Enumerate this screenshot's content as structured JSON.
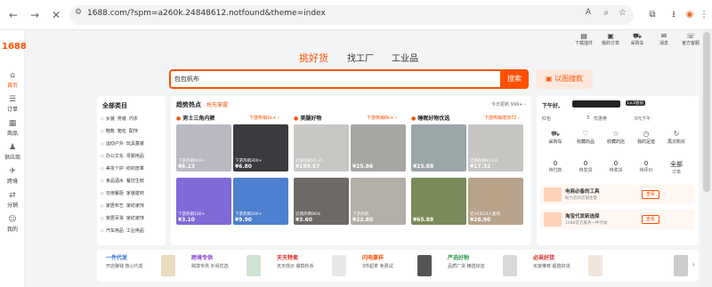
{
  "browser": {
    "url": "1688.com/?spm=a260k.24848612.notfound&theme=index",
    "back_icon": "←",
    "forward_icon": "→",
    "reload_icon": "✕",
    "info_icon": "⚙",
    "translate_icon": "A",
    "zoom_icon": "⌕",
    "star_icon": "☆",
    "extensions_icon": "⧉",
    "download_icon": "⭳",
    "avatar_icon": "◉",
    "menu_icon": "⋮"
  },
  "site": {
    "logo": "1688",
    "rail": [
      {
        "icon": "⌂",
        "label": "首页"
      },
      {
        "icon": "☰",
        "label": "订单"
      },
      {
        "icon": "▦",
        "label": "商品"
      },
      {
        "icon": "♟",
        "label": "供应商"
      },
      {
        "icon": "✈",
        "label": "跨境"
      },
      {
        "icon": "⇄",
        "label": "分销"
      },
      {
        "icon": "☺",
        "label": "我的"
      }
    ],
    "top_icons": [
      {
        "icon": "▤",
        "label": "下载插件"
      },
      {
        "icon": "▣",
        "label": "我的订单"
      },
      {
        "icon": "⛟",
        "label": "采购车"
      },
      {
        "icon": "✉",
        "label": "消息"
      },
      {
        "icon": "☏",
        "label": "官方客服"
      }
    ],
    "tabs": [
      "挑好货",
      "找工厂",
      "工业品"
    ],
    "search_value": "包包帆布",
    "search_button": "搜索",
    "image_search": "以图搜款",
    "image_search_icon": "▣",
    "accent": "#ff5000"
  },
  "categories": {
    "title": "全部类目",
    "rows": [
      [
        "女装",
        "男装",
        "内衣"
      ],
      [
        "鞋靴",
        "箱包",
        "配饰"
      ],
      [
        "运动户外",
        "玩具童装"
      ],
      [
        "办公文化",
        "母婴用品"
      ],
      [
        "美妆个护",
        "纺织皮革"
      ],
      [
        "食品酒水",
        "餐饮生鲜"
      ],
      [
        "日用餐厨",
        "家装建材"
      ],
      [
        "家居布艺",
        "家纺家饰"
      ],
      [
        "家居百货",
        "家纺家饰"
      ],
      [
        "汽车用品",
        "工业用品"
      ]
    ],
    "row_icon": "◇"
  },
  "hot": {
    "title": "趋势热点",
    "subtitle": "抢先掌握",
    "more": "今日更新 999+ ›",
    "columns": [
      {
        "title": "男士三角内裤",
        "sub": "下游热销1k+ ›",
        "tiles": [
          {
            "cap": "下游热销600+",
            "price": "¥6.23",
            "color": "#b9b9c2"
          },
          {
            "cap": "下游热销300+",
            "price": "¥6.80",
            "color": "#3a3a3f"
          },
          {
            "cap": "下游热销100+",
            "price": "¥3.10",
            "color": "#7f6ad8"
          },
          {
            "cap": "下游热销200+",
            "price": "¥9.90",
            "color": "#4f7fcf"
          }
        ]
      },
      {
        "title": "美腿好物",
        "sub": "下游热销6k+ ›",
        "tiles": [
          {
            "cap": "近期热销¥5.25",
            "price": "¥189.57",
            "color": "#c9c7c4"
          },
          {
            "cap": "",
            "price": "¥25.86",
            "color": "#a8a6a3"
          },
          {
            "cap": "近期热销96%",
            "price": "¥3.60",
            "color": "#6d6a66"
          },
          {
            "cap": "下游热销",
            "price": "¥22.80",
            "color": "#b3aea6"
          }
        ]
      },
      {
        "title": "睡眠好物优选",
        "sub": "下游热销增加72 ›",
        "tiles": [
          {
            "cap": "",
            "price": "¥25.88",
            "color": "#9aa6a8"
          },
          {
            "cap": "近期热销¥15.8",
            "price": "¥17.32",
            "color": "#c8c6c2"
          },
          {
            "cap": "",
            "price": "¥65.88",
            "color": "#7a8a5a"
          },
          {
            "cap": "近30天53人复购",
            "price": "¥28.90",
            "color": "#b7a28a"
          }
        ]
      }
    ]
  },
  "user": {
    "greeting": "下午好,",
    "level": "Lv.3会员",
    "red_packet": "红包",
    "coupons": "3",
    "coupons_label": "优惠券",
    "balance": "0元下午",
    "quick": [
      {
        "icon": "⛟",
        "label": "采购车"
      },
      {
        "icon": "♡",
        "label": "收藏的品"
      },
      {
        "icon": "☆",
        "label": "收藏的店"
      },
      {
        "icon": "◷",
        "label": "我的足迹"
      },
      {
        "icon": "↻",
        "label": "再次购买"
      }
    ],
    "stats": [
      {
        "n": "0",
        "l": "待付款"
      },
      {
        "n": "0",
        "l": "待发货"
      },
      {
        "n": "0",
        "l": "待收货"
      },
      {
        "n": "0",
        "l": "待评价"
      },
      {
        "n": "全部",
        "l": "订单"
      }
    ],
    "promos": [
      {
        "t": "电商必备的工具",
        "s": "助力您的店铺生意",
        "b": "查看"
      },
      {
        "t": "淘宝代发新选择",
        "s": "1688官方服务一件代发",
        "b": "查看"
      }
    ]
  },
  "strip": [
    {
      "t": "一件代发",
      "s": "开店赚钱 放心代发",
      "color": "#2f6fd6"
    },
    {
      "t": "跨境专供",
      "s": "跨境专供 外贸优选",
      "color": "#8a3fd1"
    },
    {
      "t": "天天特卖",
      "s": "天天低价 爆款秒杀",
      "color": "#e02020"
    },
    {
      "t": "闪电拿样",
      "s": "3件起拿 免费试",
      "color": "#ff5000"
    },
    {
      "t": "严选好物",
      "s": "品质厂货 精选好店",
      "color": "#2a9a46"
    },
    {
      "t": "必采好货",
      "s": "买家推荐 超值好货",
      "color": "#e02020"
    },
    {
      "t": "",
      "s": "",
      "color": "#333"
    }
  ]
}
